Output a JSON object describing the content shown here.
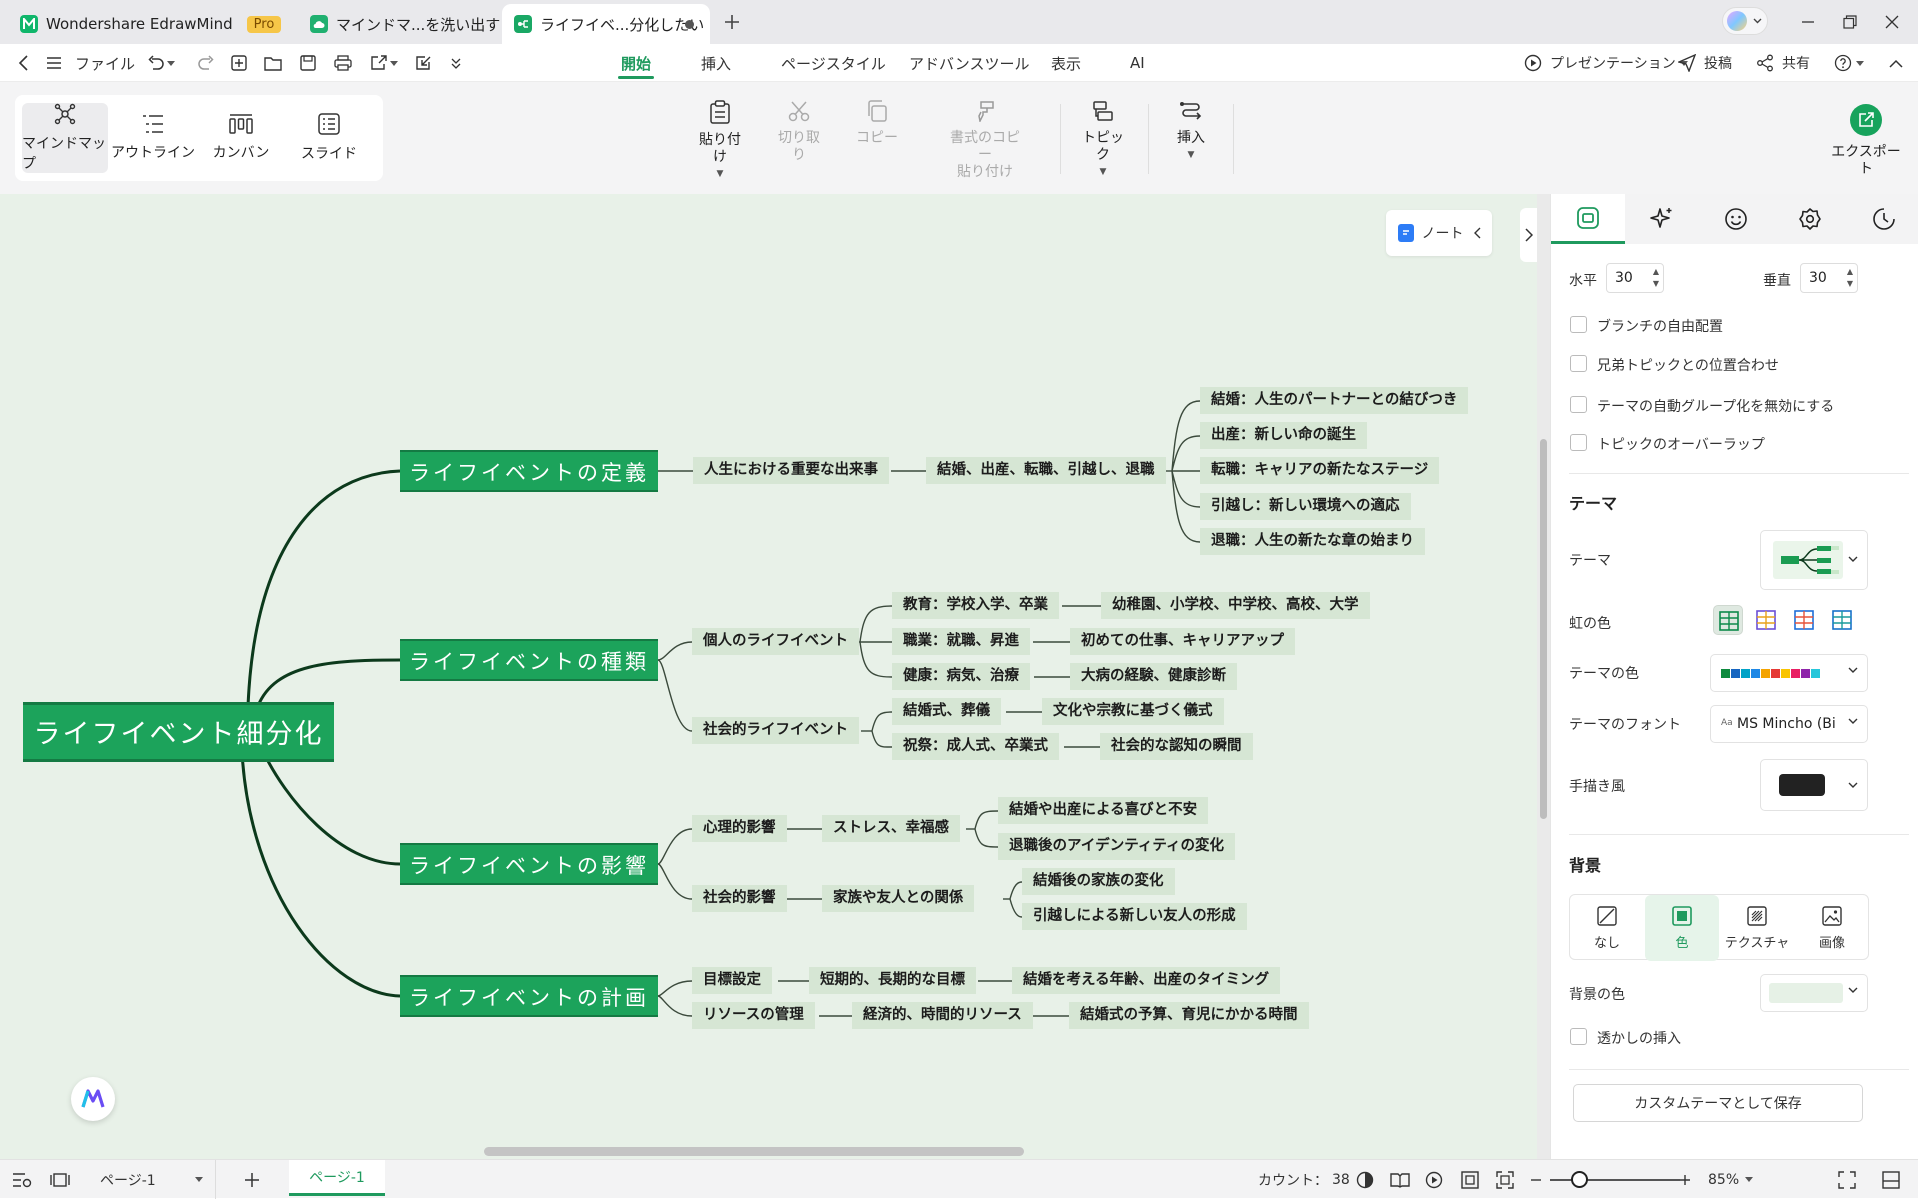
{
  "titlebar": {
    "tabs": [
      {
        "label": "Wondershare EdrawMind",
        "badge": "Pro"
      },
      {
        "label": "マインドマ...を洗い出す"
      },
      {
        "label": "ライフイベ...分化したい"
      }
    ]
  },
  "menu": {
    "file": "ファイル",
    "tabs": [
      "開始",
      "挿入",
      "ページスタイル",
      "アドバンスツール",
      "表示",
      "AI"
    ],
    "presentation": "プレゼンテーション",
    "post": "投稿",
    "share": "共有"
  },
  "ribbon": {
    "modes": [
      "マインドマップ",
      "アウトライン",
      "カンバン",
      "スライド"
    ],
    "paste": "貼り付け",
    "cut": "切り取り",
    "copy": "コピー",
    "format_copy_1": "書式のコピー",
    "format_copy_2": "貼り付け",
    "topic": "トピック",
    "insert": "挿入",
    "export": "エクスポート"
  },
  "canvas": {
    "note": "ノート"
  },
  "mindmap": {
    "root": "ライフイベント細分化",
    "main": [
      "ライフイベントの定義",
      "ライフイベントの種類",
      "ライフイベントの影響",
      "ライフイベントの計画"
    ],
    "nodes": {
      "def_l1": "人生における重要な出来事",
      "def_l2": "結婚、出産、転職、引越し、退職",
      "def_l3": [
        "結婚：人生のパートナーとの結びつき",
        "出産：新しい命の誕生",
        "転職：キャリアの新たなステージ",
        "引越し：新しい環境への適応",
        "退職：人生の新たな章の始まり"
      ],
      "types_personal": "個人のライフイベント",
      "types_social": "社会的ライフイベント",
      "types_p": [
        "教育：学校入学、卒業",
        "職業：就職、昇進",
        "健康：病気、治療"
      ],
      "types_p_detail": [
        "幼稚園、小学校、中学校、高校、大学",
        "初めての仕事、キャリアアップ",
        "大病の経験、健康診断"
      ],
      "types_s": [
        "結婚式、葬儀",
        "祝祭：成人式、卒業式"
      ],
      "types_s_detail": [
        "文化や宗教に基づく儀式",
        "社会的な認知の瞬間"
      ],
      "impact_psych": "心理的影響",
      "impact_social": "社会的影響",
      "impact_psych_l2": "ストレス、幸福感",
      "impact_social_l2": "家族や友人との関係",
      "impact_psych_l3": [
        "結婚や出産による喜びと不安",
        "退職後のアイデンティティの変化"
      ],
      "impact_social_l3": [
        "結婚後の家族の変化",
        "引越しによる新しい友人の形成"
      ],
      "plan_goal": "目標設定",
      "plan_goal_l2": "短期的、長期的な目標",
      "plan_goal_l3": "結婚を考える年齢、出産のタイミング",
      "plan_res": "リソースの管理",
      "plan_res_l2": "経済的、時間的リソース",
      "plan_res_l3": "結婚式の予算、育児にかかる時間"
    }
  },
  "panel": {
    "horizontal_label": "水平",
    "horizontal_value": "30",
    "vertical_label": "垂直",
    "vertical_value": "30",
    "checkboxes": [
      "ブランチの自由配置",
      "兄弟トピックとの位置合わせ",
      "テーマの自動グループ化を無効にする",
      "トピックのオーバーラップ"
    ],
    "theme_heading": "テーマ",
    "theme_label": "テーマ",
    "rainbow_label": "虹の色",
    "theme_color_label": "テーマの色",
    "theme_color_swatches": [
      "#0e8a3e",
      "#1565c0",
      "#00a2c7",
      "#1e88e5",
      "#f4a300",
      "#e53935",
      "#f9c400",
      "#e91e63",
      "#8e24aa",
      "#26c6da"
    ],
    "theme_font_label": "テーマのフォント",
    "theme_font_value": "MS Mincho (Bi",
    "handdrawn_label": "手描き風",
    "bg_heading": "背景",
    "bg_options": [
      "なし",
      "色",
      "テクスチャ",
      "画像"
    ],
    "bg_color_label": "背景の色",
    "watermark_label": "透かしの挿入",
    "save_theme": "カスタムテーマとして保存"
  },
  "statusbar": {
    "page_select": "ページ-1",
    "page_tab": "ページ-1",
    "count_label": "カウント：",
    "count_value": "38",
    "zoom": "85%"
  },
  "colors": {
    "accent": "#1f9a5e",
    "branch": "#1ca35b",
    "topic_bg": "#d6e6d4",
    "canvas_bg": "#e8f1e8"
  }
}
